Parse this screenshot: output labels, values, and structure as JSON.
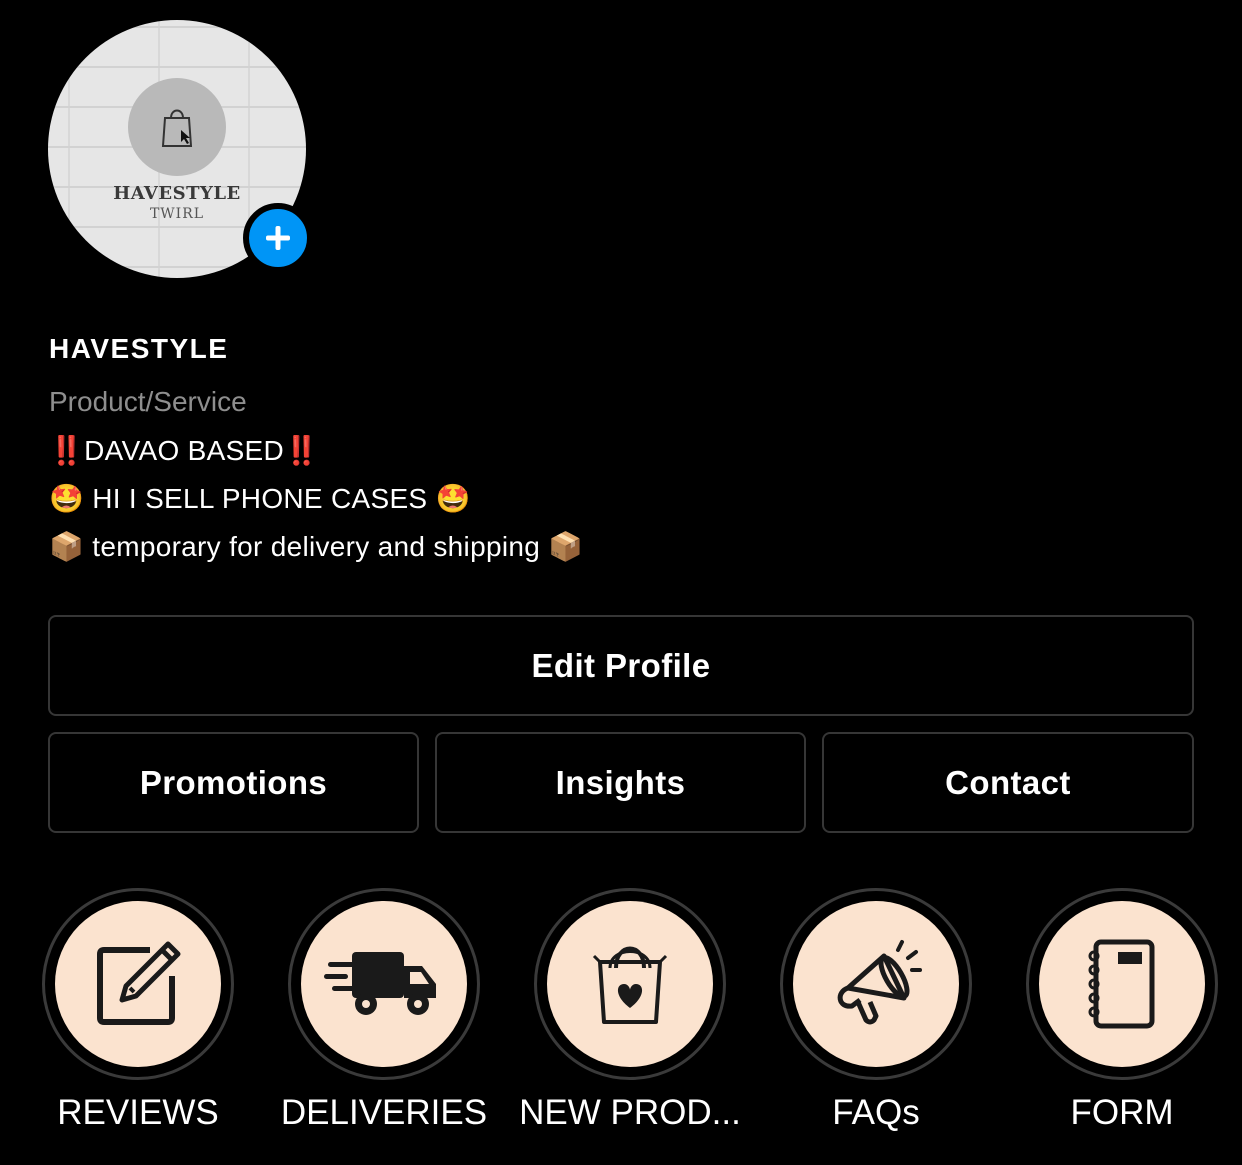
{
  "profile": {
    "avatar_brand": "HAVESTYLE",
    "avatar_sub": "TWIRL",
    "username": "HAVESTYLE",
    "category": "Product/Service",
    "bio_lines": [
      "‼️DAVAO BASED‼️",
      "🤩 HI I SELL PHONE CASES 🤩",
      "📦 temporary for delivery and shipping 📦"
    ]
  },
  "buttons": {
    "edit_profile": "Edit Profile",
    "promotions": "Promotions",
    "insights": "Insights",
    "contact": "Contact"
  },
  "highlights": [
    {
      "label": "REVIEWS",
      "icon": "pencil-square-icon"
    },
    {
      "label": "DELIVERIES",
      "icon": "delivery-truck-icon"
    },
    {
      "label": "NEW PROD...",
      "icon": "shopping-bag-heart-icon"
    },
    {
      "label": "FAQs",
      "icon": "megaphone-icon"
    },
    {
      "label": "FORM",
      "icon": "notebook-icon"
    }
  ],
  "colors": {
    "background": "#000000",
    "accent_blue": "#0095f6",
    "highlight_fill": "#fbe3cf",
    "border": "#363636",
    "secondary_text": "#8e8e8e"
  }
}
